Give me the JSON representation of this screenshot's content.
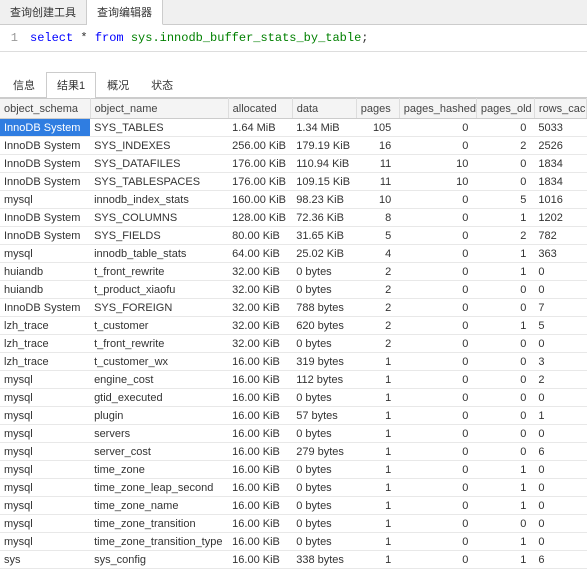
{
  "top_tabs": {
    "tools": "查询创建工具",
    "editor": "查询编辑器"
  },
  "sql": {
    "line": "1",
    "select": "select",
    "star": "*",
    "from": "from",
    "ident": "sys.innodb_buffer_stats_by_table",
    "semi": ";"
  },
  "result_tabs": {
    "info": "信息",
    "result1": "结果1",
    "profile": "概况",
    "status": "状态"
  },
  "headers": {
    "object_schema": "object_schema",
    "object_name": "object_name",
    "allocated": "allocated",
    "data": "data",
    "pages": "pages",
    "pages_hashed": "pages_hashed",
    "pages_old": "pages_old",
    "rows_cached": "rows_cached"
  },
  "rows": [
    {
      "s": "InnoDB System",
      "n": "SYS_TABLES",
      "a": "1.64 MiB",
      "d": "1.34 MiB",
      "p": "105",
      "ph": "0",
      "po": "0",
      "rc": "5033",
      "sel": true
    },
    {
      "s": "InnoDB System",
      "n": "SYS_INDEXES",
      "a": "256.00 KiB",
      "d": "179.19 KiB",
      "p": "16",
      "ph": "0",
      "po": "2",
      "rc": "2526"
    },
    {
      "s": "InnoDB System",
      "n": "SYS_DATAFILES",
      "a": "176.00 KiB",
      "d": "110.94 KiB",
      "p": "11",
      "ph": "10",
      "po": "0",
      "rc": "1834"
    },
    {
      "s": "InnoDB System",
      "n": "SYS_TABLESPACES",
      "a": "176.00 KiB",
      "d": "109.15 KiB",
      "p": "11",
      "ph": "10",
      "po": "0",
      "rc": "1834"
    },
    {
      "s": "mysql",
      "n": "innodb_index_stats",
      "a": "160.00 KiB",
      "d": "98.23 KiB",
      "p": "10",
      "ph": "0",
      "po": "5",
      "rc": "1016"
    },
    {
      "s": "InnoDB System",
      "n": "SYS_COLUMNS",
      "a": "128.00 KiB",
      "d": "72.36 KiB",
      "p": "8",
      "ph": "0",
      "po": "1",
      "rc": "1202"
    },
    {
      "s": "InnoDB System",
      "n": "SYS_FIELDS",
      "a": "80.00 KiB",
      "d": "31.65 KiB",
      "p": "5",
      "ph": "0",
      "po": "2",
      "rc": "782"
    },
    {
      "s": "mysql",
      "n": "innodb_table_stats",
      "a": "64.00 KiB",
      "d": "25.02 KiB",
      "p": "4",
      "ph": "0",
      "po": "1",
      "rc": "363"
    },
    {
      "s": "huiandb",
      "n": "t_front_rewrite",
      "a": "32.00 KiB",
      "d": "0 bytes",
      "p": "2",
      "ph": "0",
      "po": "1",
      "rc": "0"
    },
    {
      "s": "huiandb",
      "n": "t_product_xiaofu",
      "a": "32.00 KiB",
      "d": "0 bytes",
      "p": "2",
      "ph": "0",
      "po": "0",
      "rc": "0"
    },
    {
      "s": "InnoDB System",
      "n": "SYS_FOREIGN",
      "a": "32.00 KiB",
      "d": "788 bytes",
      "p": "2",
      "ph": "0",
      "po": "0",
      "rc": "7"
    },
    {
      "s": "lzh_trace",
      "n": "t_customer",
      "a": "32.00 KiB",
      "d": "620 bytes",
      "p": "2",
      "ph": "0",
      "po": "1",
      "rc": "5"
    },
    {
      "s": "lzh_trace",
      "n": "t_front_rewrite",
      "a": "32.00 KiB",
      "d": "0 bytes",
      "p": "2",
      "ph": "0",
      "po": "0",
      "rc": "0"
    },
    {
      "s": "lzh_trace",
      "n": "t_customer_wx",
      "a": "16.00 KiB",
      "d": "319 bytes",
      "p": "1",
      "ph": "0",
      "po": "0",
      "rc": "3"
    },
    {
      "s": "mysql",
      "n": "engine_cost",
      "a": "16.00 KiB",
      "d": "112 bytes",
      "p": "1",
      "ph": "0",
      "po": "0",
      "rc": "2"
    },
    {
      "s": "mysql",
      "n": "gtid_executed",
      "a": "16.00 KiB",
      "d": "0 bytes",
      "p": "1",
      "ph": "0",
      "po": "0",
      "rc": "0"
    },
    {
      "s": "mysql",
      "n": "plugin",
      "a": "16.00 KiB",
      "d": "57 bytes",
      "p": "1",
      "ph": "0",
      "po": "0",
      "rc": "1"
    },
    {
      "s": "mysql",
      "n": "servers",
      "a": "16.00 KiB",
      "d": "0 bytes",
      "p": "1",
      "ph": "0",
      "po": "0",
      "rc": "0"
    },
    {
      "s": "mysql",
      "n": "server_cost",
      "a": "16.00 KiB",
      "d": "279 bytes",
      "p": "1",
      "ph": "0",
      "po": "0",
      "rc": "6"
    },
    {
      "s": "mysql",
      "n": "time_zone",
      "a": "16.00 KiB",
      "d": "0 bytes",
      "p": "1",
      "ph": "0",
      "po": "1",
      "rc": "0"
    },
    {
      "s": "mysql",
      "n": "time_zone_leap_second",
      "a": "16.00 KiB",
      "d": "0 bytes",
      "p": "1",
      "ph": "0",
      "po": "1",
      "rc": "0"
    },
    {
      "s": "mysql",
      "n": "time_zone_name",
      "a": "16.00 KiB",
      "d": "0 bytes",
      "p": "1",
      "ph": "0",
      "po": "1",
      "rc": "0"
    },
    {
      "s": "mysql",
      "n": "time_zone_transition",
      "a": "16.00 KiB",
      "d": "0 bytes",
      "p": "1",
      "ph": "0",
      "po": "0",
      "rc": "0"
    },
    {
      "s": "mysql",
      "n": "time_zone_transition_type",
      "a": "16.00 KiB",
      "d": "0 bytes",
      "p": "1",
      "ph": "0",
      "po": "1",
      "rc": "0"
    },
    {
      "s": "sys",
      "n": "sys_config",
      "a": "16.00 KiB",
      "d": "338 bytes",
      "p": "1",
      "ph": "0",
      "po": "1",
      "rc": "6"
    }
  ]
}
